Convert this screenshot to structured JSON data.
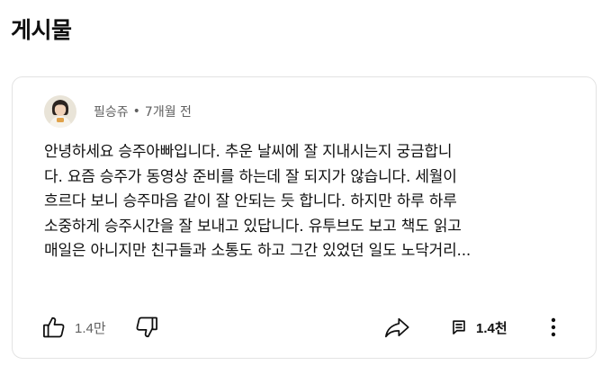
{
  "section": {
    "title": "게시물"
  },
  "post": {
    "author": "필승쥬",
    "separator": "•",
    "time": "7개월 전",
    "text_lines": [
      "안녕하세요 승주아빠입니다. 추운 날씨에 잘 지내시는지 궁금합니",
      "다. 요즘 승주가 동영상 준비를 하는데 잘 되지가 않습니다. 세월이",
      "흐르다 보니 승주마음 같이 잘 안되는 듯 합니다. 하지만 하루 하루",
      "소중하게 승주시간을 잘 보내고 있답니다. 유투브도 보고 책도 읽고",
      "매일은 아니지만 친구들과 소통도 하고 그간 있었던 일도 노닥거리..."
    ],
    "like_count": "1.4만",
    "comment_count": "1.4천"
  },
  "icons": {
    "like": "thumbs-up-icon",
    "dislike": "thumbs-down-icon",
    "share": "share-arrow-icon",
    "comment": "comment-icon",
    "more": "more-vertical-icon"
  },
  "colors": {
    "text_primary": "#0f0f0f",
    "text_secondary": "#606060",
    "card_border": "#e3e3e3"
  }
}
